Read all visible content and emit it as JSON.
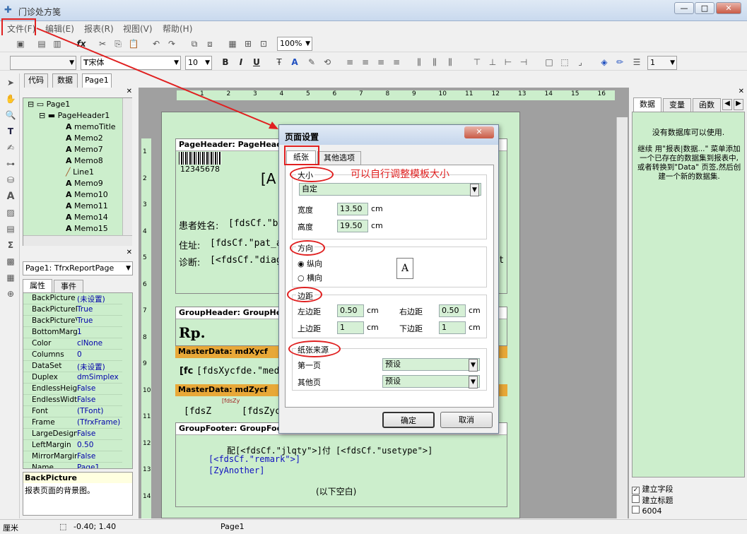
{
  "window": {
    "title": "门诊处方笺",
    "min": "—",
    "max": "□",
    "close": "✕"
  },
  "menu": [
    "文件(F)",
    "编辑(E)",
    "报表(R)",
    "视图(V)",
    "帮助(H)"
  ],
  "toolbar": {
    "zoom": "100%",
    "font_name": "宋体",
    "font_size": "10",
    "line_width": "1",
    "bold": "B",
    "italic": "I",
    "underline": "U",
    "fx": "fx"
  },
  "left_tabs": [
    "代码",
    "数据",
    "Page1"
  ],
  "tree": [
    "Page1",
    "PageHeader1",
    "memoTitle",
    "Memo2",
    "Memo7",
    "Memo8",
    "Line1",
    "Memo9",
    "Memo10",
    "Memo11",
    "Memo14",
    "Memo15"
  ],
  "obj_combo": "Page1: TfrxReportPage",
  "prop_tabs": [
    "属性",
    "事件"
  ],
  "props": [
    {
      "k": "BackPicture",
      "v": "(未设置)"
    },
    {
      "k": "BackPicturePrint",
      "v": "True"
    },
    {
      "k": "BackPictureVisible",
      "v": "True"
    },
    {
      "k": "BottomMargin",
      "v": "1"
    },
    {
      "k": "Color",
      "v": "clNone"
    },
    {
      "k": "Columns",
      "v": "0"
    },
    {
      "k": "DataSet",
      "v": "(未设置)"
    },
    {
      "k": "Duplex",
      "v": "dmSimplex"
    },
    {
      "k": "EndlessHeight",
      "v": "False"
    },
    {
      "k": "EndlessWidth",
      "v": "False"
    },
    {
      "k": "Font",
      "v": "(TFont)"
    },
    {
      "k": "Frame",
      "v": "(TfrxFrame)"
    },
    {
      "k": "LargeDesignHeight",
      "v": "False"
    },
    {
      "k": "LeftMargin",
      "v": "0.50"
    },
    {
      "k": "MirrorMargins",
      "v": "False"
    },
    {
      "k": "Name",
      "v": "Page1"
    }
  ],
  "prop_help": {
    "title": "BackPicture",
    "desc": "报表页面的背景图。"
  },
  "ruler_numbers": [
    "1",
    "2",
    "3",
    "4",
    "5",
    "6",
    "7",
    "8",
    "9",
    "10",
    "11",
    "12",
    "13",
    "14",
    "15",
    "16"
  ],
  "vruler_numbers": [
    "1",
    "2",
    "3",
    "4",
    "5",
    "6",
    "7",
    "8",
    "9",
    "10",
    "11",
    "12",
    "13",
    "14"
  ],
  "report": {
    "page_header": "PageHeader: PageHeader1",
    "barcode": "12345678",
    "big_a": "[A",
    "patient": "患者姓名:",
    "patient_val": "[fdsCf.\"b",
    "addr": "住址:",
    "addr_val": "[fdsCf.\"pat_a",
    "diag": "诊断:",
    "diag_val": "[<fdsCf.\"diag",
    "diag_tail": "at",
    "group_header": "GroupHeader: GroupHeade",
    "rp": "Rp.",
    "master1": "MasterData: mdXycf",
    "master1_val": "[fdsXycfde.\"med_",
    "master1_pre": "[fc",
    "master2": "MasterData: mdZycf",
    "master2_a": "[fdsZ",
    "master2_b": "[fdsZyc",
    "master2_small": "[fdsZy",
    "group_footer": "GroupFooter: GroupFooter",
    "footer_line": "配[<fdsCf.\"jlqty\">]付 [<fdsCf.\"usetype\">]",
    "remark": "[<fdsCf.\"remark\">]",
    "another": "[ZyAnother]",
    "blank": "(以下空白)"
  },
  "dialog": {
    "title": "页面设置",
    "tabs": [
      "纸张",
      "其他选项"
    ],
    "size_label": "大小",
    "size_value": "自定",
    "width_label": "宽度",
    "width": "13.50",
    "height_label": "高度",
    "height": "19.50",
    "unit": "cm",
    "orient_label": "方向",
    "portrait": "纵向",
    "landscape": "横向",
    "margin_label": "边距",
    "left_label": "左边距",
    "left": "0.50",
    "right_label": "右边距",
    "right": "0.50",
    "top_label": "上边距",
    "top": "1",
    "bottom_label": "下边距",
    "bottom": "1",
    "source_label": "纸张来源",
    "first_label": "第一页",
    "first": "预设",
    "other_label": "其他页",
    "other": "预设",
    "ok": "确定",
    "cancel": "取消"
  },
  "annotation": "可以自行调整模板大小",
  "right_tabs": [
    "数据",
    "变量",
    "函数"
  ],
  "right_msg1": "没有数据库可以使用.",
  "right_msg2": "继续 用\"报表|数据...\" 菜单添加一个已存在的数据集到报表中,或者转换到\"Data\" 页签,然后创建一个新的数据集.",
  "right_checks": [
    {
      "label": "建立字段",
      "checked": true
    },
    {
      "label": "建立标题",
      "checked": false
    },
    {
      "label": "6004",
      "checked": false
    }
  ],
  "status": {
    "unit": "厘米",
    "coords": "-0.40; 1.40",
    "page": "Page1"
  },
  "colors": {
    "green": "#cceecc",
    "accent_red": "#e02020",
    "band_orange": "#e8a838"
  }
}
